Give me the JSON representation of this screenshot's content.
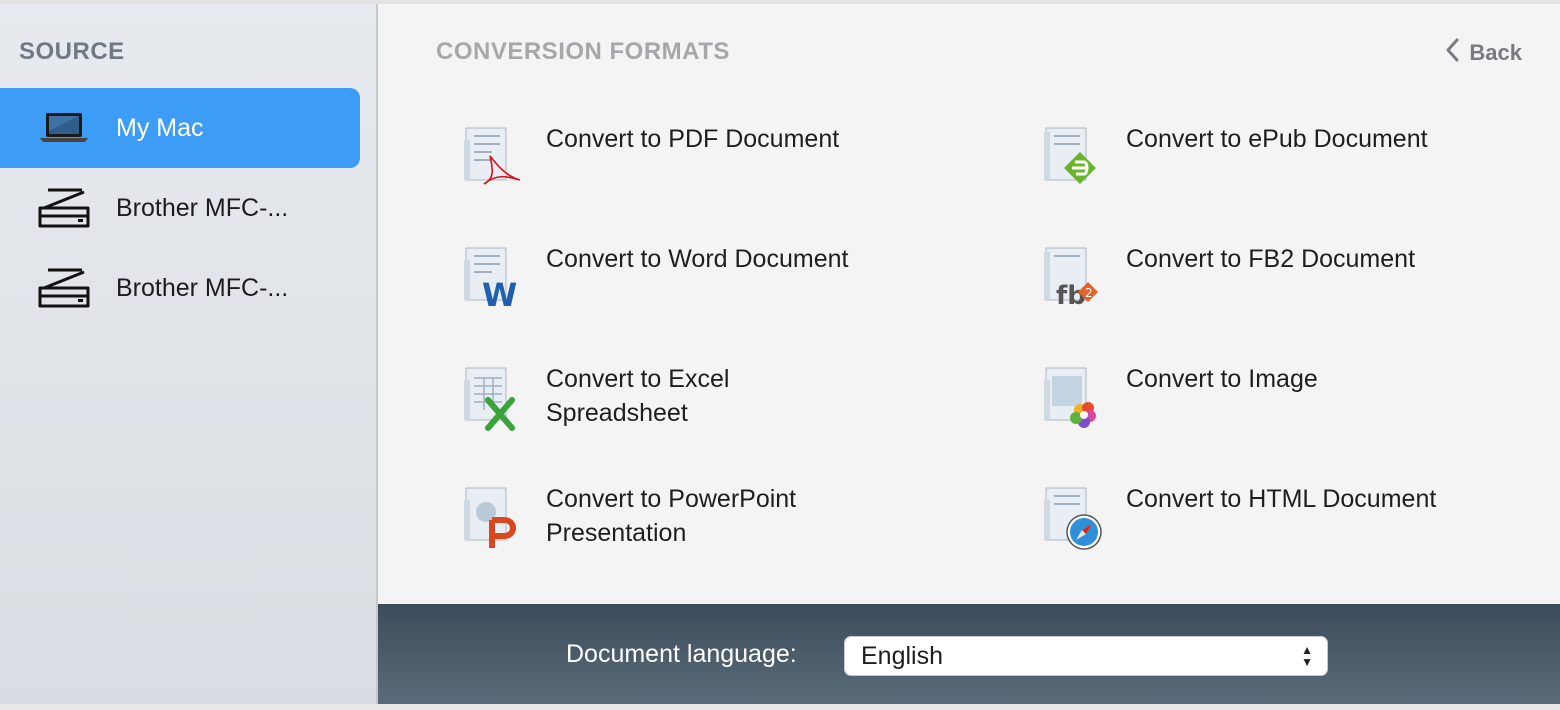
{
  "sidebar": {
    "title": "SOURCE",
    "items": [
      {
        "label": "My Mac",
        "icon": "laptop-icon",
        "selected": true
      },
      {
        "label": "Brother MFC-...",
        "icon": "scanner-icon",
        "selected": false
      },
      {
        "label": "Brother MFC-...",
        "icon": "scanner-icon",
        "selected": false
      }
    ]
  },
  "main": {
    "title": "CONVERSION FORMATS",
    "back_label": "Back",
    "formats": [
      {
        "label": "Convert to PDF Document",
        "icon": "pdf-document-icon"
      },
      {
        "label": "Convert to ePub Document",
        "icon": "epub-document-icon"
      },
      {
        "label": "Convert to Word Document",
        "icon": "word-document-icon"
      },
      {
        "label": "Convert to FB2 Document",
        "icon": "fb2-document-icon"
      },
      {
        "label": "Convert to Excel Spreadsheet",
        "icon": "excel-spreadsheet-icon"
      },
      {
        "label": "Convert to Image",
        "icon": "image-document-icon"
      },
      {
        "label": "Convert to PowerPoint Presentation",
        "icon": "powerpoint-presentation-icon"
      },
      {
        "label": "Convert to HTML Document",
        "icon": "html-document-icon"
      }
    ]
  },
  "footer": {
    "language_label": "Document language:",
    "language_value": "English"
  },
  "colors": {
    "selection": "#3d9df6",
    "bottom_bar": "#4a5b6a"
  }
}
